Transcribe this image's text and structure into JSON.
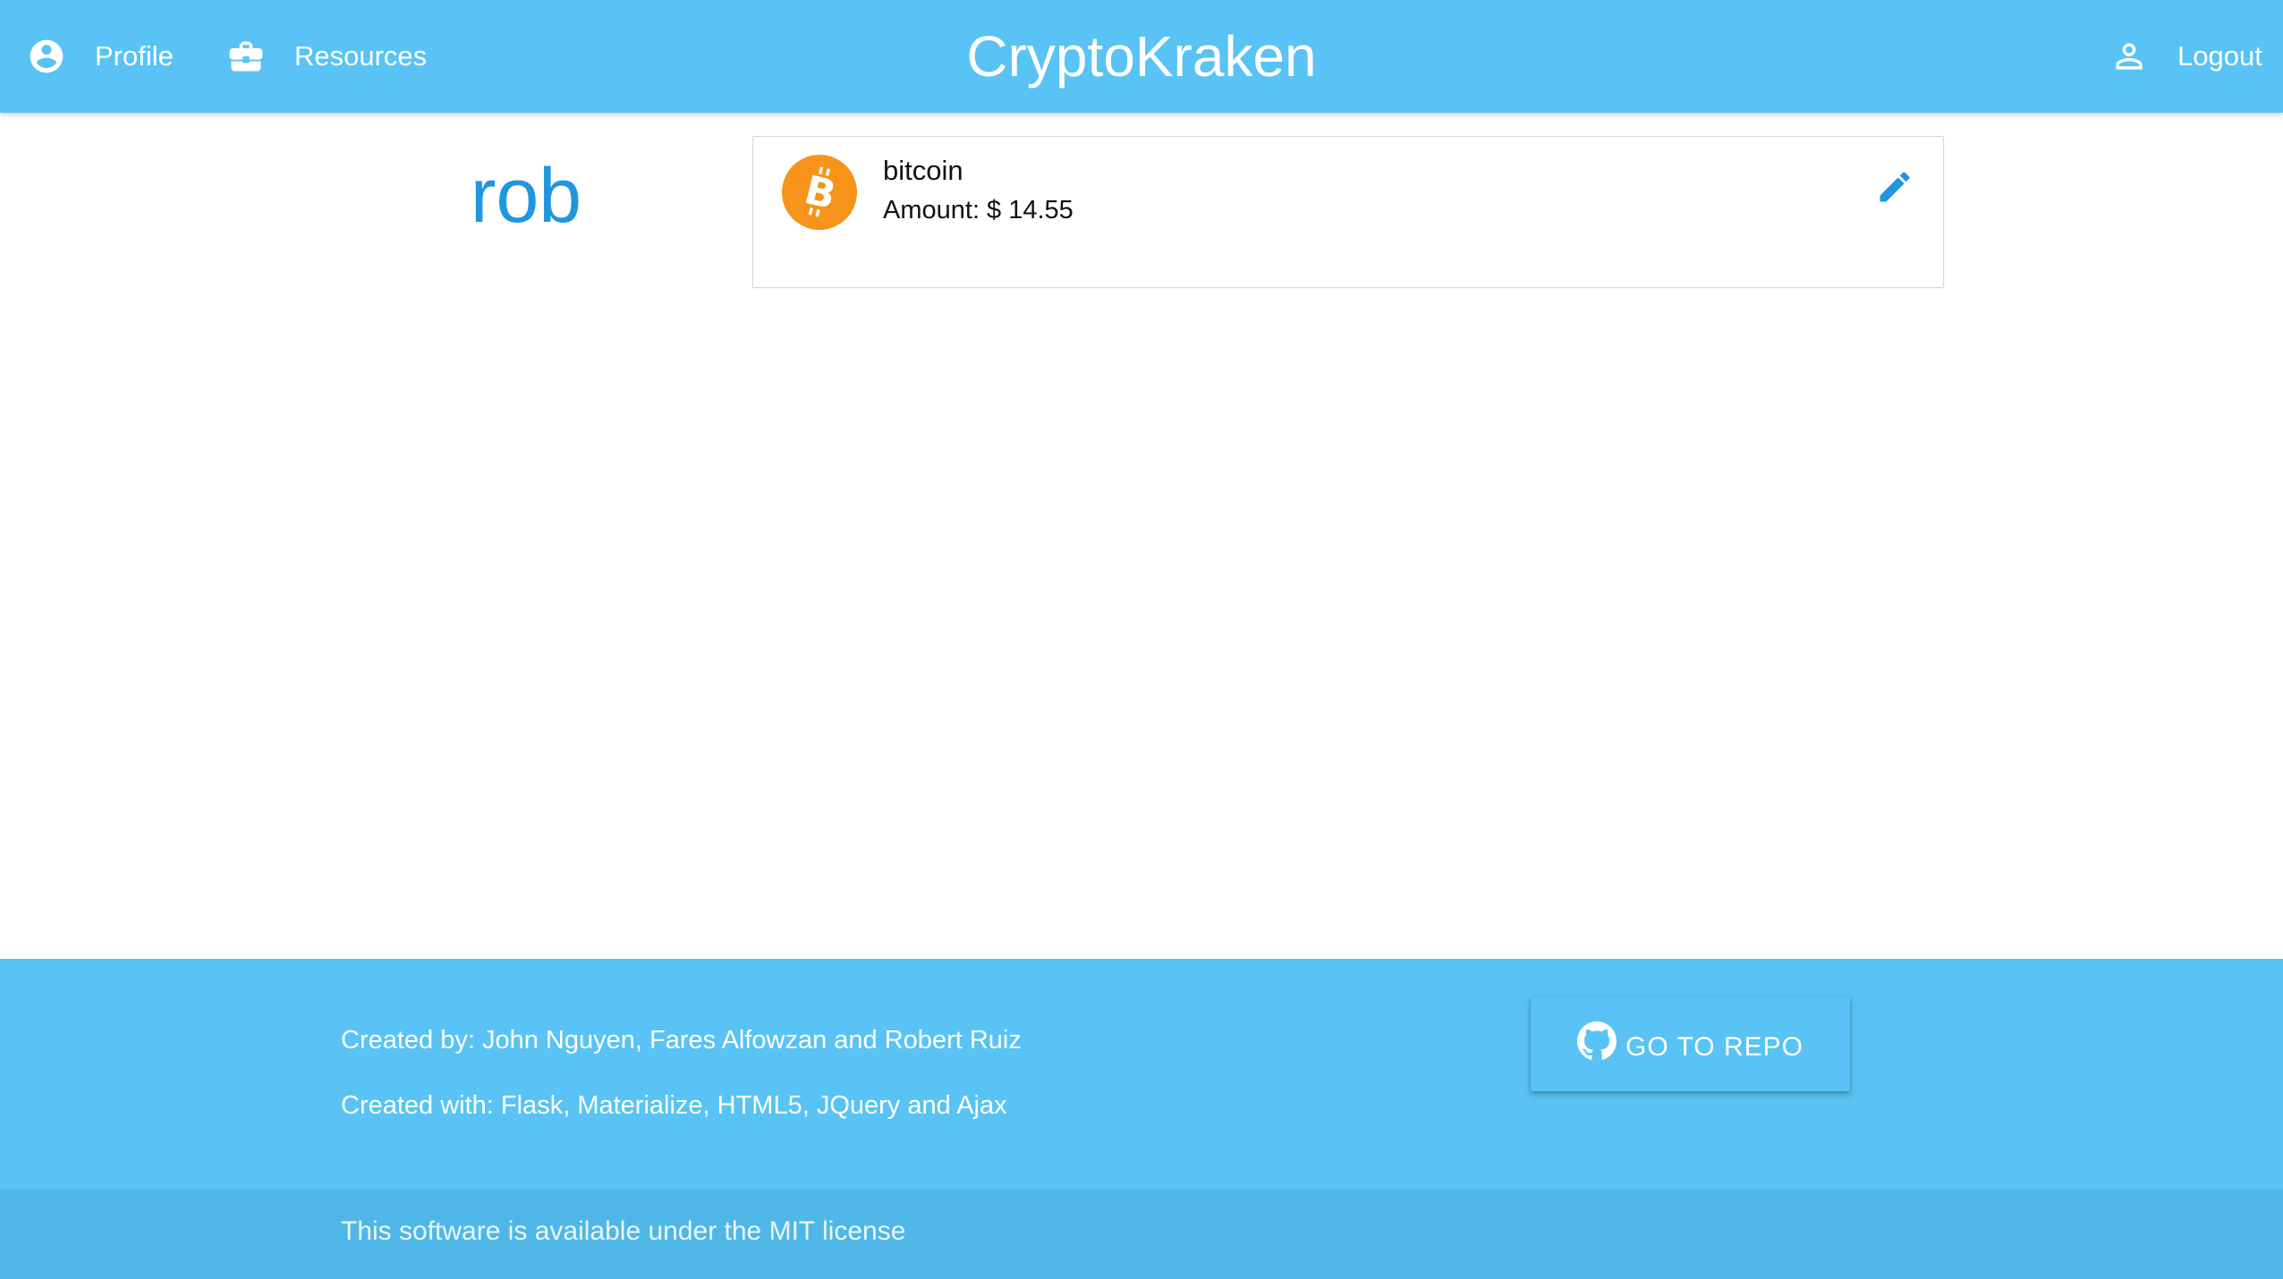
{
  "nav": {
    "profile_label": "Profile",
    "resources_label": "Resources",
    "brand": "CryptoKraken",
    "logout_label": "Logout",
    "icons": {
      "profile": "account-circle-icon",
      "resources": "briefcase-icon",
      "logout": "person-outline-icon"
    }
  },
  "user": {
    "username": "rob"
  },
  "holdings": [
    {
      "name": "bitcoin",
      "amount_text": "Amount: $ 14.55",
      "icon": "bitcoin-icon",
      "edit_icon": "pencil-icon"
    }
  ],
  "footer": {
    "created_by": "Created by: John Nguyen, Fares Alfowzan and Robert Ruiz",
    "created_with": "Created with: Flask, Materialize, HTML5, JQuery and Ajax",
    "repo_button": "GO TO REPO",
    "repo_icon": "github-icon",
    "license": "This software is available under the MIT license"
  },
  "colors": {
    "primary": "#58c3f4",
    "accent": "#2196e0",
    "bitcoin": "#f7931a",
    "footer_copyright": "#4fb7e8"
  }
}
